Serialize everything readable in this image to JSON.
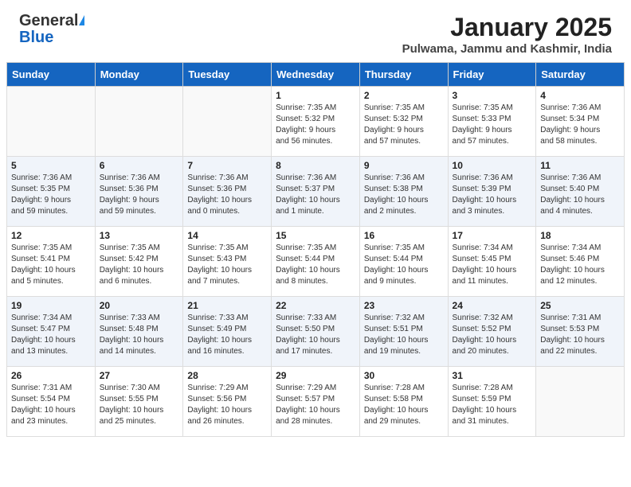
{
  "header": {
    "logo_general": "General",
    "logo_blue": "Blue",
    "title": "January 2025",
    "subtitle": "Pulwama, Jammu and Kashmir, India"
  },
  "calendar": {
    "headers": [
      "Sunday",
      "Monday",
      "Tuesday",
      "Wednesday",
      "Thursday",
      "Friday",
      "Saturday"
    ],
    "rows": [
      [
        {
          "day": "",
          "info": ""
        },
        {
          "day": "",
          "info": ""
        },
        {
          "day": "",
          "info": ""
        },
        {
          "day": "1",
          "info": "Sunrise: 7:35 AM\nSunset: 5:32 PM\nDaylight: 9 hours\nand 56 minutes."
        },
        {
          "day": "2",
          "info": "Sunrise: 7:35 AM\nSunset: 5:32 PM\nDaylight: 9 hours\nand 57 minutes."
        },
        {
          "day": "3",
          "info": "Sunrise: 7:35 AM\nSunset: 5:33 PM\nDaylight: 9 hours\nand 57 minutes."
        },
        {
          "day": "4",
          "info": "Sunrise: 7:36 AM\nSunset: 5:34 PM\nDaylight: 9 hours\nand 58 minutes."
        }
      ],
      [
        {
          "day": "5",
          "info": "Sunrise: 7:36 AM\nSunset: 5:35 PM\nDaylight: 9 hours\nand 59 minutes."
        },
        {
          "day": "6",
          "info": "Sunrise: 7:36 AM\nSunset: 5:36 PM\nDaylight: 9 hours\nand 59 minutes."
        },
        {
          "day": "7",
          "info": "Sunrise: 7:36 AM\nSunset: 5:36 PM\nDaylight: 10 hours\nand 0 minutes."
        },
        {
          "day": "8",
          "info": "Sunrise: 7:36 AM\nSunset: 5:37 PM\nDaylight: 10 hours\nand 1 minute."
        },
        {
          "day": "9",
          "info": "Sunrise: 7:36 AM\nSunset: 5:38 PM\nDaylight: 10 hours\nand 2 minutes."
        },
        {
          "day": "10",
          "info": "Sunrise: 7:36 AM\nSunset: 5:39 PM\nDaylight: 10 hours\nand 3 minutes."
        },
        {
          "day": "11",
          "info": "Sunrise: 7:36 AM\nSunset: 5:40 PM\nDaylight: 10 hours\nand 4 minutes."
        }
      ],
      [
        {
          "day": "12",
          "info": "Sunrise: 7:35 AM\nSunset: 5:41 PM\nDaylight: 10 hours\nand 5 minutes."
        },
        {
          "day": "13",
          "info": "Sunrise: 7:35 AM\nSunset: 5:42 PM\nDaylight: 10 hours\nand 6 minutes."
        },
        {
          "day": "14",
          "info": "Sunrise: 7:35 AM\nSunset: 5:43 PM\nDaylight: 10 hours\nand 7 minutes."
        },
        {
          "day": "15",
          "info": "Sunrise: 7:35 AM\nSunset: 5:44 PM\nDaylight: 10 hours\nand 8 minutes."
        },
        {
          "day": "16",
          "info": "Sunrise: 7:35 AM\nSunset: 5:44 PM\nDaylight: 10 hours\nand 9 minutes."
        },
        {
          "day": "17",
          "info": "Sunrise: 7:34 AM\nSunset: 5:45 PM\nDaylight: 10 hours\nand 11 minutes."
        },
        {
          "day": "18",
          "info": "Sunrise: 7:34 AM\nSunset: 5:46 PM\nDaylight: 10 hours\nand 12 minutes."
        }
      ],
      [
        {
          "day": "19",
          "info": "Sunrise: 7:34 AM\nSunset: 5:47 PM\nDaylight: 10 hours\nand 13 minutes."
        },
        {
          "day": "20",
          "info": "Sunrise: 7:33 AM\nSunset: 5:48 PM\nDaylight: 10 hours\nand 14 minutes."
        },
        {
          "day": "21",
          "info": "Sunrise: 7:33 AM\nSunset: 5:49 PM\nDaylight: 10 hours\nand 16 minutes."
        },
        {
          "day": "22",
          "info": "Sunrise: 7:33 AM\nSunset: 5:50 PM\nDaylight: 10 hours\nand 17 minutes."
        },
        {
          "day": "23",
          "info": "Sunrise: 7:32 AM\nSunset: 5:51 PM\nDaylight: 10 hours\nand 19 minutes."
        },
        {
          "day": "24",
          "info": "Sunrise: 7:32 AM\nSunset: 5:52 PM\nDaylight: 10 hours\nand 20 minutes."
        },
        {
          "day": "25",
          "info": "Sunrise: 7:31 AM\nSunset: 5:53 PM\nDaylight: 10 hours\nand 22 minutes."
        }
      ],
      [
        {
          "day": "26",
          "info": "Sunrise: 7:31 AM\nSunset: 5:54 PM\nDaylight: 10 hours\nand 23 minutes."
        },
        {
          "day": "27",
          "info": "Sunrise: 7:30 AM\nSunset: 5:55 PM\nDaylight: 10 hours\nand 25 minutes."
        },
        {
          "day": "28",
          "info": "Sunrise: 7:29 AM\nSunset: 5:56 PM\nDaylight: 10 hours\nand 26 minutes."
        },
        {
          "day": "29",
          "info": "Sunrise: 7:29 AM\nSunset: 5:57 PM\nDaylight: 10 hours\nand 28 minutes."
        },
        {
          "day": "30",
          "info": "Sunrise: 7:28 AM\nSunset: 5:58 PM\nDaylight: 10 hours\nand 29 minutes."
        },
        {
          "day": "31",
          "info": "Sunrise: 7:28 AM\nSunset: 5:59 PM\nDaylight: 10 hours\nand 31 minutes."
        },
        {
          "day": "",
          "info": ""
        }
      ]
    ]
  }
}
